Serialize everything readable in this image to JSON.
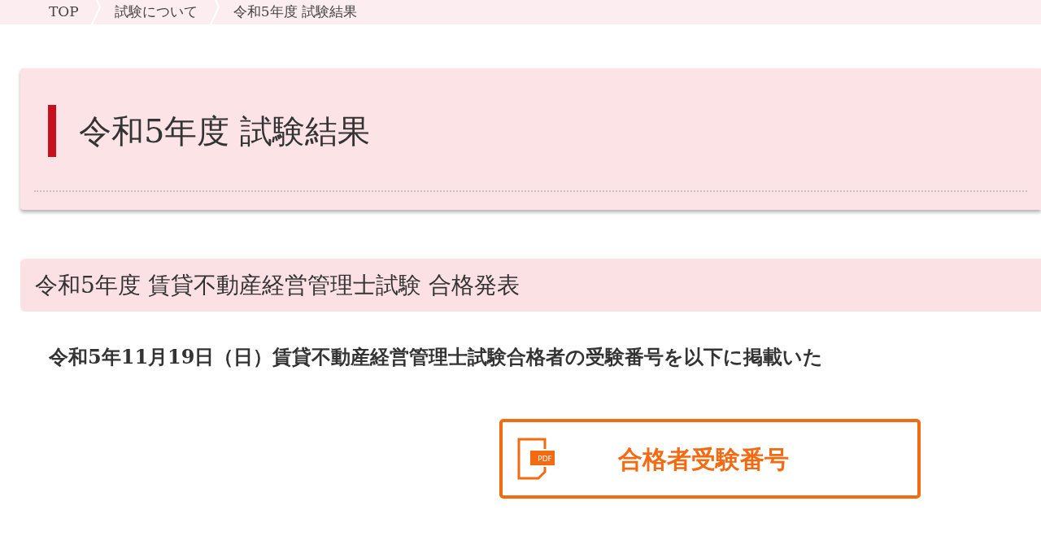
{
  "breadcrumb": [
    {
      "label": "TOP"
    },
    {
      "label": "試験について"
    },
    {
      "label": "令和5年度 試験結果"
    }
  ],
  "page_title": "令和5年度 試験結果",
  "section_heading": "令和5年度 賃貸不動産経営管理士試験 合格発表",
  "notice": "令和5年11月19日（日）賃貸不動産経営管理士試験合格者の受験番号を以下に掲載いた",
  "download_button": {
    "label": "合格者受験番号",
    "icon_text": "PDF"
  }
}
